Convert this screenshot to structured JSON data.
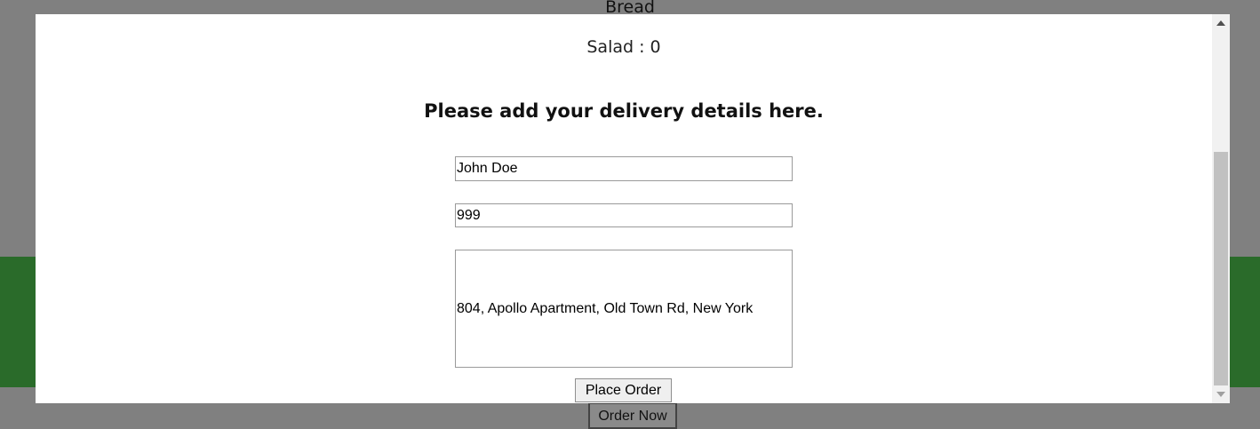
{
  "background": {
    "heading": "Bread",
    "order_now_label": "Order Now",
    "band_color": "#2a6b2a",
    "overlay_color": "#808080"
  },
  "modal": {
    "salad_line": "Salad : 0",
    "heading": "Please add your delivery details here.",
    "fields": {
      "name_value": "John Doe",
      "phone_value": "999",
      "address_value": "804, Apollo Apartment, Old Town Rd, New York"
    },
    "place_order_label": "Place Order"
  },
  "scrollbar": {
    "up_icon": "triangle-up-icon",
    "down_icon": "triangle-down-icon"
  }
}
